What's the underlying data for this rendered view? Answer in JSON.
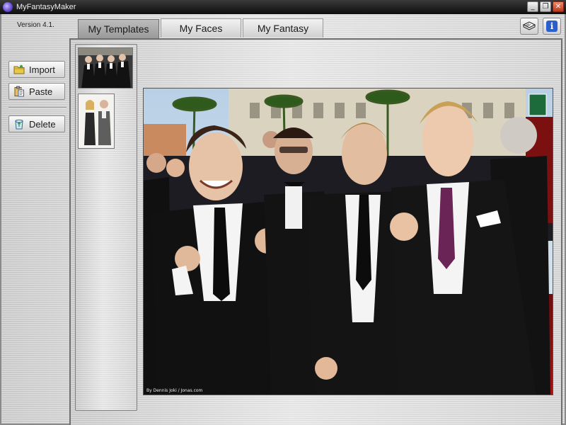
{
  "titlebar": {
    "title": "MyFantasyMaker",
    "icon": "app-icon",
    "buttons": [
      {
        "name": "minimize-button",
        "glyph": "_"
      },
      {
        "name": "maximize-button",
        "glyph": "❐"
      },
      {
        "name": "close-button",
        "glyph": "✕"
      }
    ]
  },
  "header": {
    "version": "Version 4.1.",
    "tabs": [
      {
        "label": "My Templates",
        "active": true
      },
      {
        "label": "My Faces",
        "active": false
      },
      {
        "label": "My Fantasy",
        "active": false
      }
    ],
    "icons": [
      "manual-book-icon",
      "info-icon"
    ]
  },
  "sidebar": {
    "buttons": [
      {
        "label": "Import",
        "icon": "folder-icon"
      },
      {
        "label": "Paste",
        "icon": "clipboard-icon"
      },
      {
        "label": "Delete",
        "icon": "recycle-bin-icon"
      }
    ]
  },
  "templates": {
    "thumbnails": [
      {
        "name": "template-thumbnail-group",
        "selected": true
      },
      {
        "name": "template-thumbnail-couple",
        "selected": false
      }
    ],
    "photo_credit": "By Dennis Joki / Jonas.com"
  },
  "colors": {
    "title_bar": "#1a1a1a",
    "metal": "#d6d6d6",
    "close_button": "#d4482a",
    "info_icon": "#2b5fd0",
    "red_carpet": "#8a1010"
  }
}
